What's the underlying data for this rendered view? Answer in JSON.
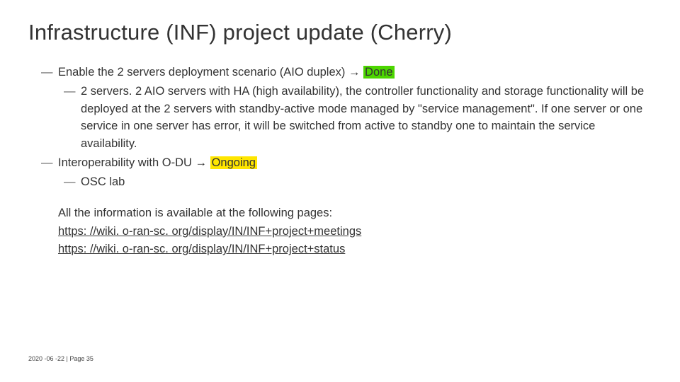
{
  "title": "Infrastructure (INF) project update (Cherry)",
  "b1": {
    "prefix": "Enable the 2 servers deployment scenario (AIO duplex) → ",
    "status": "Done",
    "sub": "2 servers. 2 AIO servers with HA (high availability), the controller functionality and storage functionality will be deployed at the 2 servers with standby-active mode managed by \"service management\". If one server or one service in one server has error, it will be switched from active to standby one to maintain the service availability."
  },
  "b2": {
    "prefix": "Interoperability with O-DU → ",
    "status": "Ongoing",
    "sub": "OSC lab"
  },
  "info": {
    "intro": "All the information is available at the following pages:",
    "link1": "https: //wiki. o-ran-sc. org/display/IN/INF+project+meetings",
    "link2": "https: //wiki. o-ran-sc. org/display/IN/INF+project+status"
  },
  "footer": "2020 -06 -22  |  Page 35"
}
